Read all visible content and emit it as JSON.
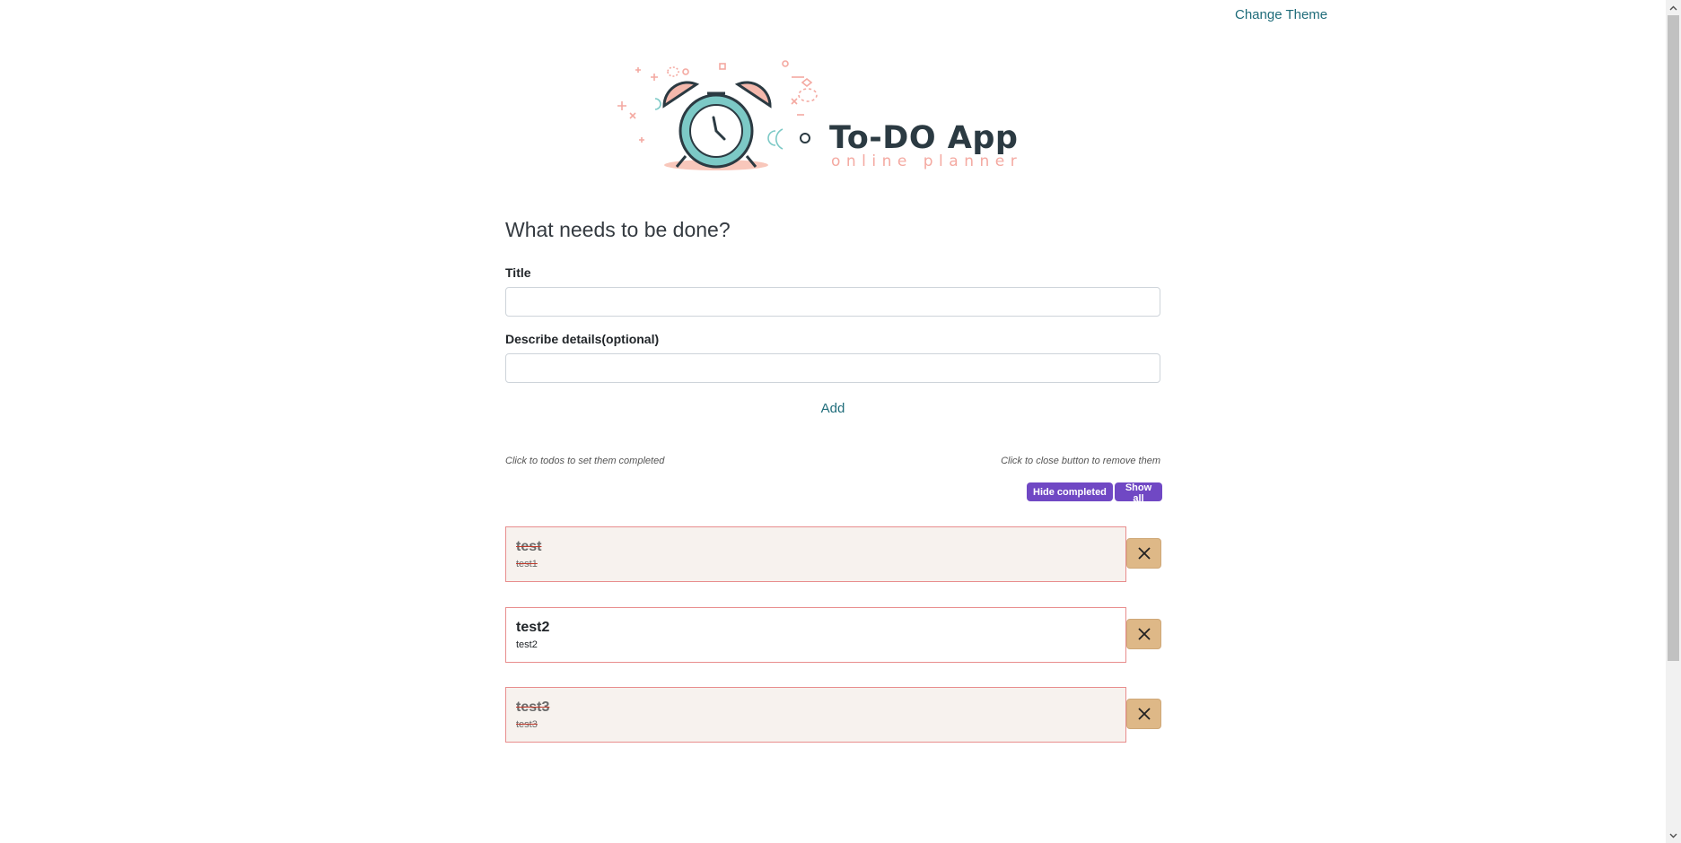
{
  "header": {
    "change_theme_label": "Change Theme"
  },
  "logo": {
    "title": "To-DO App",
    "subtitle": "online planner"
  },
  "form": {
    "heading": "What needs to be done?",
    "title_label": "Title",
    "title_value": "",
    "details_label": "Describe details(optional)",
    "details_value": "",
    "add_label": "Add"
  },
  "hints": {
    "left": "Click to todos to set them completed",
    "right": "Click to close button to remove them"
  },
  "filters": {
    "hide_completed": "Hide completed",
    "show_all": "Show all"
  },
  "todos": [
    {
      "title": "test",
      "description": "test1",
      "completed": true
    },
    {
      "title": "test2",
      "description": "test2",
      "completed": false
    },
    {
      "title": "test3",
      "description": "test3",
      "completed": true
    }
  ],
  "colors": {
    "accent_link": "#1f6c7a",
    "filter_button": "#7048c4",
    "close_button": "#deb887",
    "todo_border": "#e88d8d",
    "completed_bg": "#f7f2ee"
  },
  "icons": {
    "close": "close-icon",
    "logo": "alarm-clock-icon"
  }
}
